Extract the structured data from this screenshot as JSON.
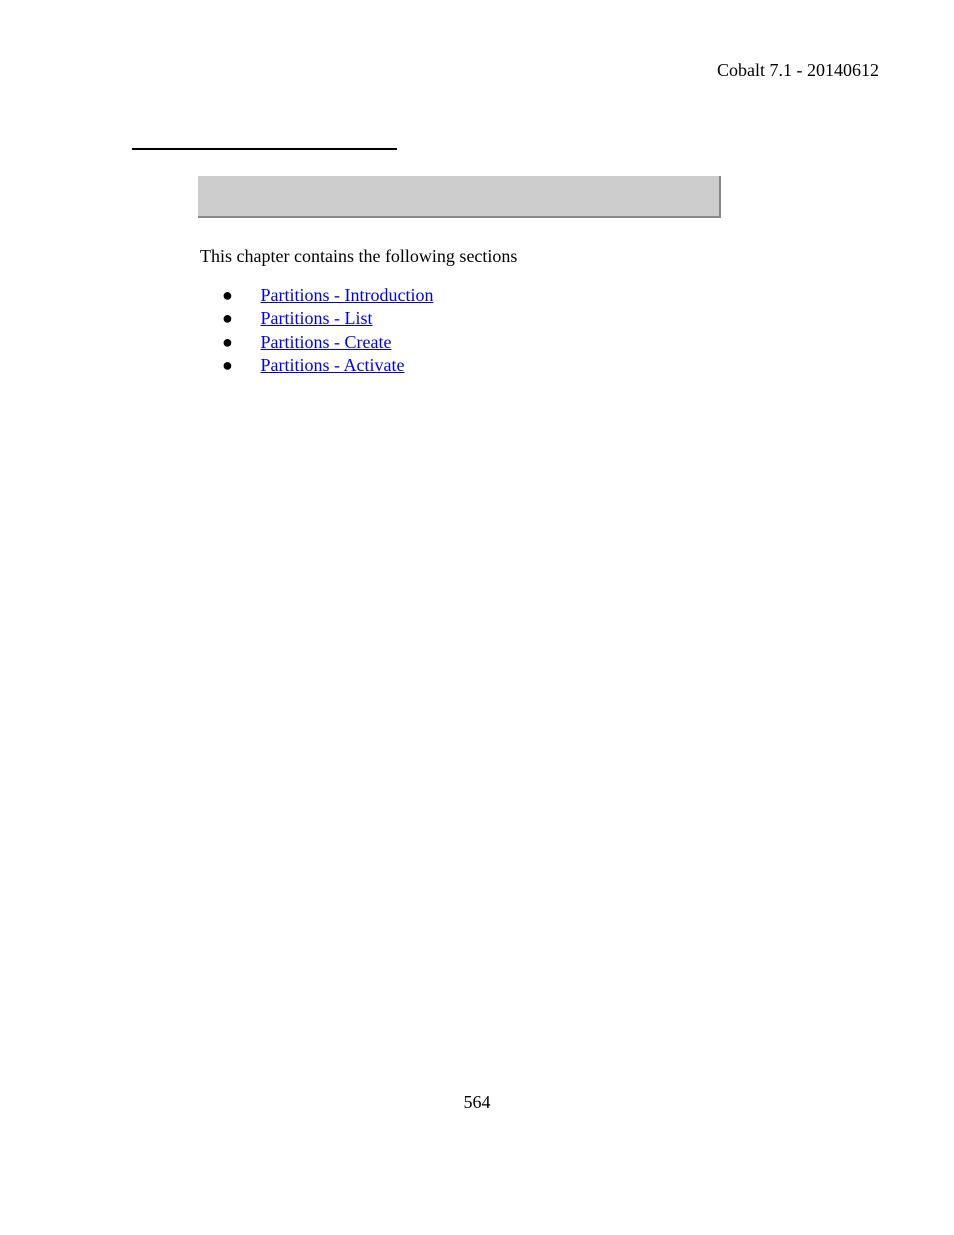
{
  "header": "Cobalt 7.1 - 20140612",
  "intro": "This chapter contains the following sections",
  "links": [
    "Partitions - Introduction",
    "Partitions - List",
    "Partitions - Create",
    "Partitions - Activate"
  ],
  "page_number": "564"
}
